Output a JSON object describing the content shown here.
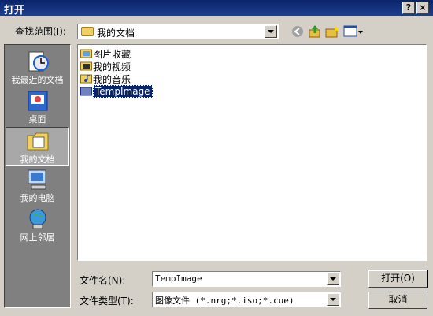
{
  "dialog": {
    "title": "打开",
    "help_glyph": "?",
    "close_glyph": "×"
  },
  "lookin": {
    "label": "查找范围(I):",
    "value": "我的文档"
  },
  "toolbar": {
    "back_icon": "back-arrow-icon",
    "up_icon": "up-folder-icon",
    "newfolder_icon": "new-folder-icon",
    "views_icon": "views-menu-icon"
  },
  "places": [
    {
      "label": "我最近的文档",
      "icon": "recent-documents-icon"
    },
    {
      "label": "桌面",
      "icon": "desktop-icon"
    },
    {
      "label": "我的文档",
      "icon": "my-documents-icon",
      "selected": true
    },
    {
      "label": "我的电脑",
      "icon": "my-computer-icon"
    },
    {
      "label": "网上邻居",
      "icon": "network-places-icon"
    }
  ],
  "files": [
    {
      "name": "图片收藏",
      "icon": "pictures-folder-icon"
    },
    {
      "name": "我的视频",
      "icon": "videos-folder-icon"
    },
    {
      "name": "我的音乐",
      "icon": "music-folder-icon"
    },
    {
      "name": "TempImage",
      "icon": "folder-icon",
      "selected": true
    }
  ],
  "filename": {
    "label": "文件名(N):",
    "value": "TempImage"
  },
  "filetype": {
    "label": "文件类型(T):",
    "value": "图像文件 (*.nrg;*.iso;*.cue)"
  },
  "buttons": {
    "open": "打开(O)",
    "cancel": "取消"
  }
}
